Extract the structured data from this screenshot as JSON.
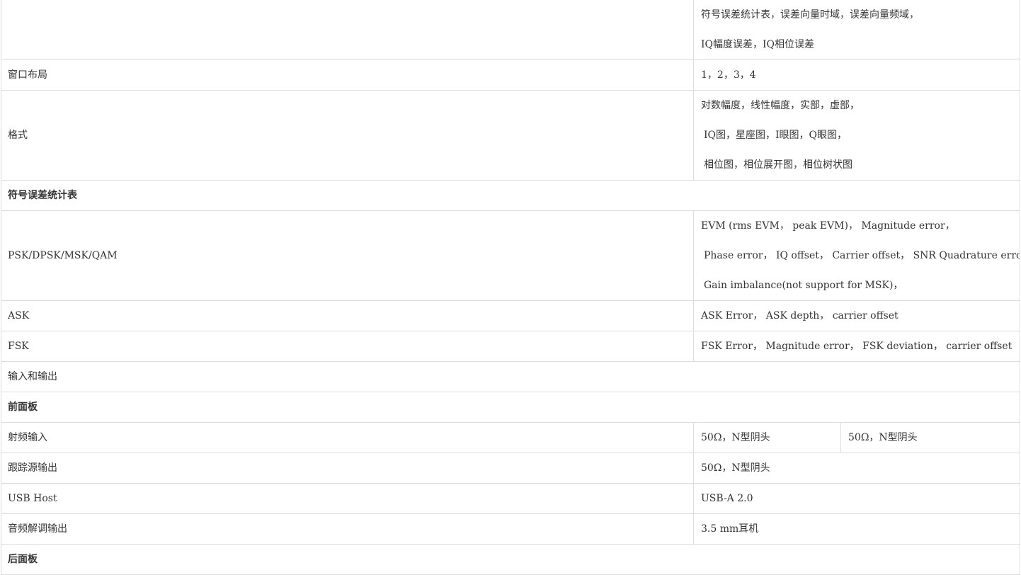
{
  "rows": [
    {
      "label": "",
      "value_lines": [
        "符号误差统计表，误差向量时域，误差向量频域，",
        "IQ幅度误差，IQ相位误差"
      ]
    },
    {
      "label": "窗口布局",
      "value_lines": [
        "1，2，3，4"
      ]
    },
    {
      "label": "格式",
      "value_lines": [
        "对数幅度，线性幅度，实部，虚部，",
        " IQ图，星座图，I眼图，Q眼图，",
        " 相位图，相位展开图，相位树状图"
      ]
    },
    {
      "section": "符号误差统计表"
    },
    {
      "label": "PSK/DPSK/MSK/QAM",
      "value_lines": [
        "EVM (rms EVM， peak EVM)， Magnitude error，",
        " Phase error， IQ offset， Carrier offset， SNR Quadrature error，",
        " Gain imbalance(not support for MSK)，"
      ]
    },
    {
      "label": "ASK",
      "value_lines": [
        "ASK Error， ASK depth， carrier offset"
      ]
    },
    {
      "label": "FSK",
      "value_lines": [
        "FSK Error， Magnitude error， FSK deviation， carrier offset"
      ]
    },
    {
      "section": "输入和输出",
      "bold": false
    },
    {
      "section": "前面板"
    },
    {
      "label": "射频输入",
      "value_lines": [
        "50Ω，N型阴头"
      ],
      "value2": "50Ω，N型阴头"
    },
    {
      "label": "跟踪源输出",
      "value_lines": [
        "50Ω，N型阴头"
      ]
    },
    {
      "label": "USB Host",
      "value_lines": [
        "USB-A 2.0"
      ]
    },
    {
      "label": "音频解调输出",
      "value_lines": [
        "3.5 mm耳机"
      ]
    },
    {
      "section": "后面板"
    }
  ]
}
